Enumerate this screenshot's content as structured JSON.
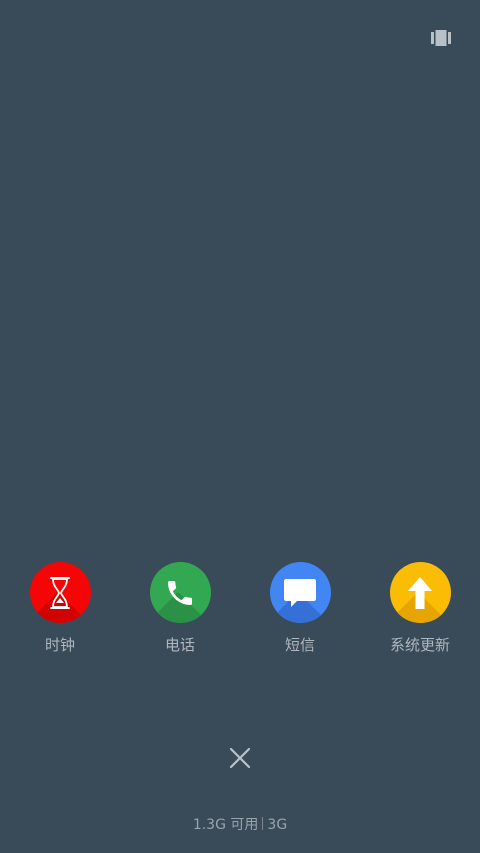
{
  "top_bar": {
    "icon": "recents-grid-icon"
  },
  "apps": [
    {
      "label": "时钟",
      "icon": "hourglass-icon",
      "color": "#f50505"
    },
    {
      "label": "电话",
      "icon": "phone-icon",
      "color": "#33a852"
    },
    {
      "label": "短信",
      "icon": "message-icon",
      "color": "#4286f4"
    },
    {
      "label": "系统更新",
      "icon": "upload-arrow-icon",
      "color": "#fbbc05"
    }
  ],
  "close": {
    "icon": "close-icon"
  },
  "memory": {
    "available": "1.3G 可用",
    "total": "3G"
  },
  "colors": {
    "background": "#394a59",
    "label": "#aeb6be"
  }
}
